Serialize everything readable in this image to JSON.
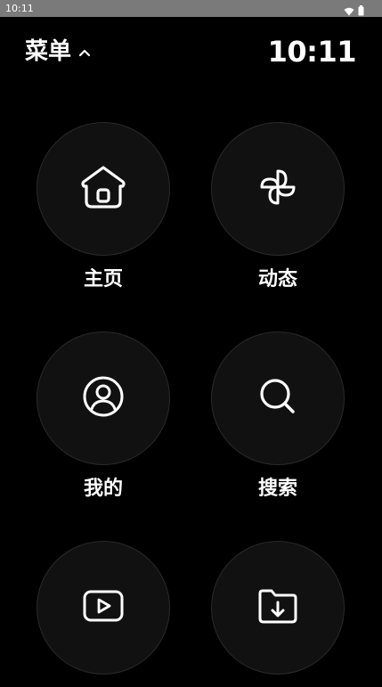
{
  "status_bar": {
    "time": "10:11",
    "icons": [
      "wifi-icon",
      "battery-icon"
    ]
  },
  "header": {
    "title": "菜单",
    "toggle_icon": "chevron-up-icon",
    "clock": "10:11"
  },
  "menu": {
    "items": [
      {
        "label": "主页",
        "icon": "home-icon"
      },
      {
        "label": "动态",
        "icon": "pinwheel-icon"
      },
      {
        "label": "我的",
        "icon": "user-circle-icon"
      },
      {
        "label": "搜索",
        "icon": "search-icon"
      },
      {
        "label": "",
        "icon": "video-play-icon"
      },
      {
        "label": "",
        "icon": "folder-download-icon"
      }
    ]
  }
}
